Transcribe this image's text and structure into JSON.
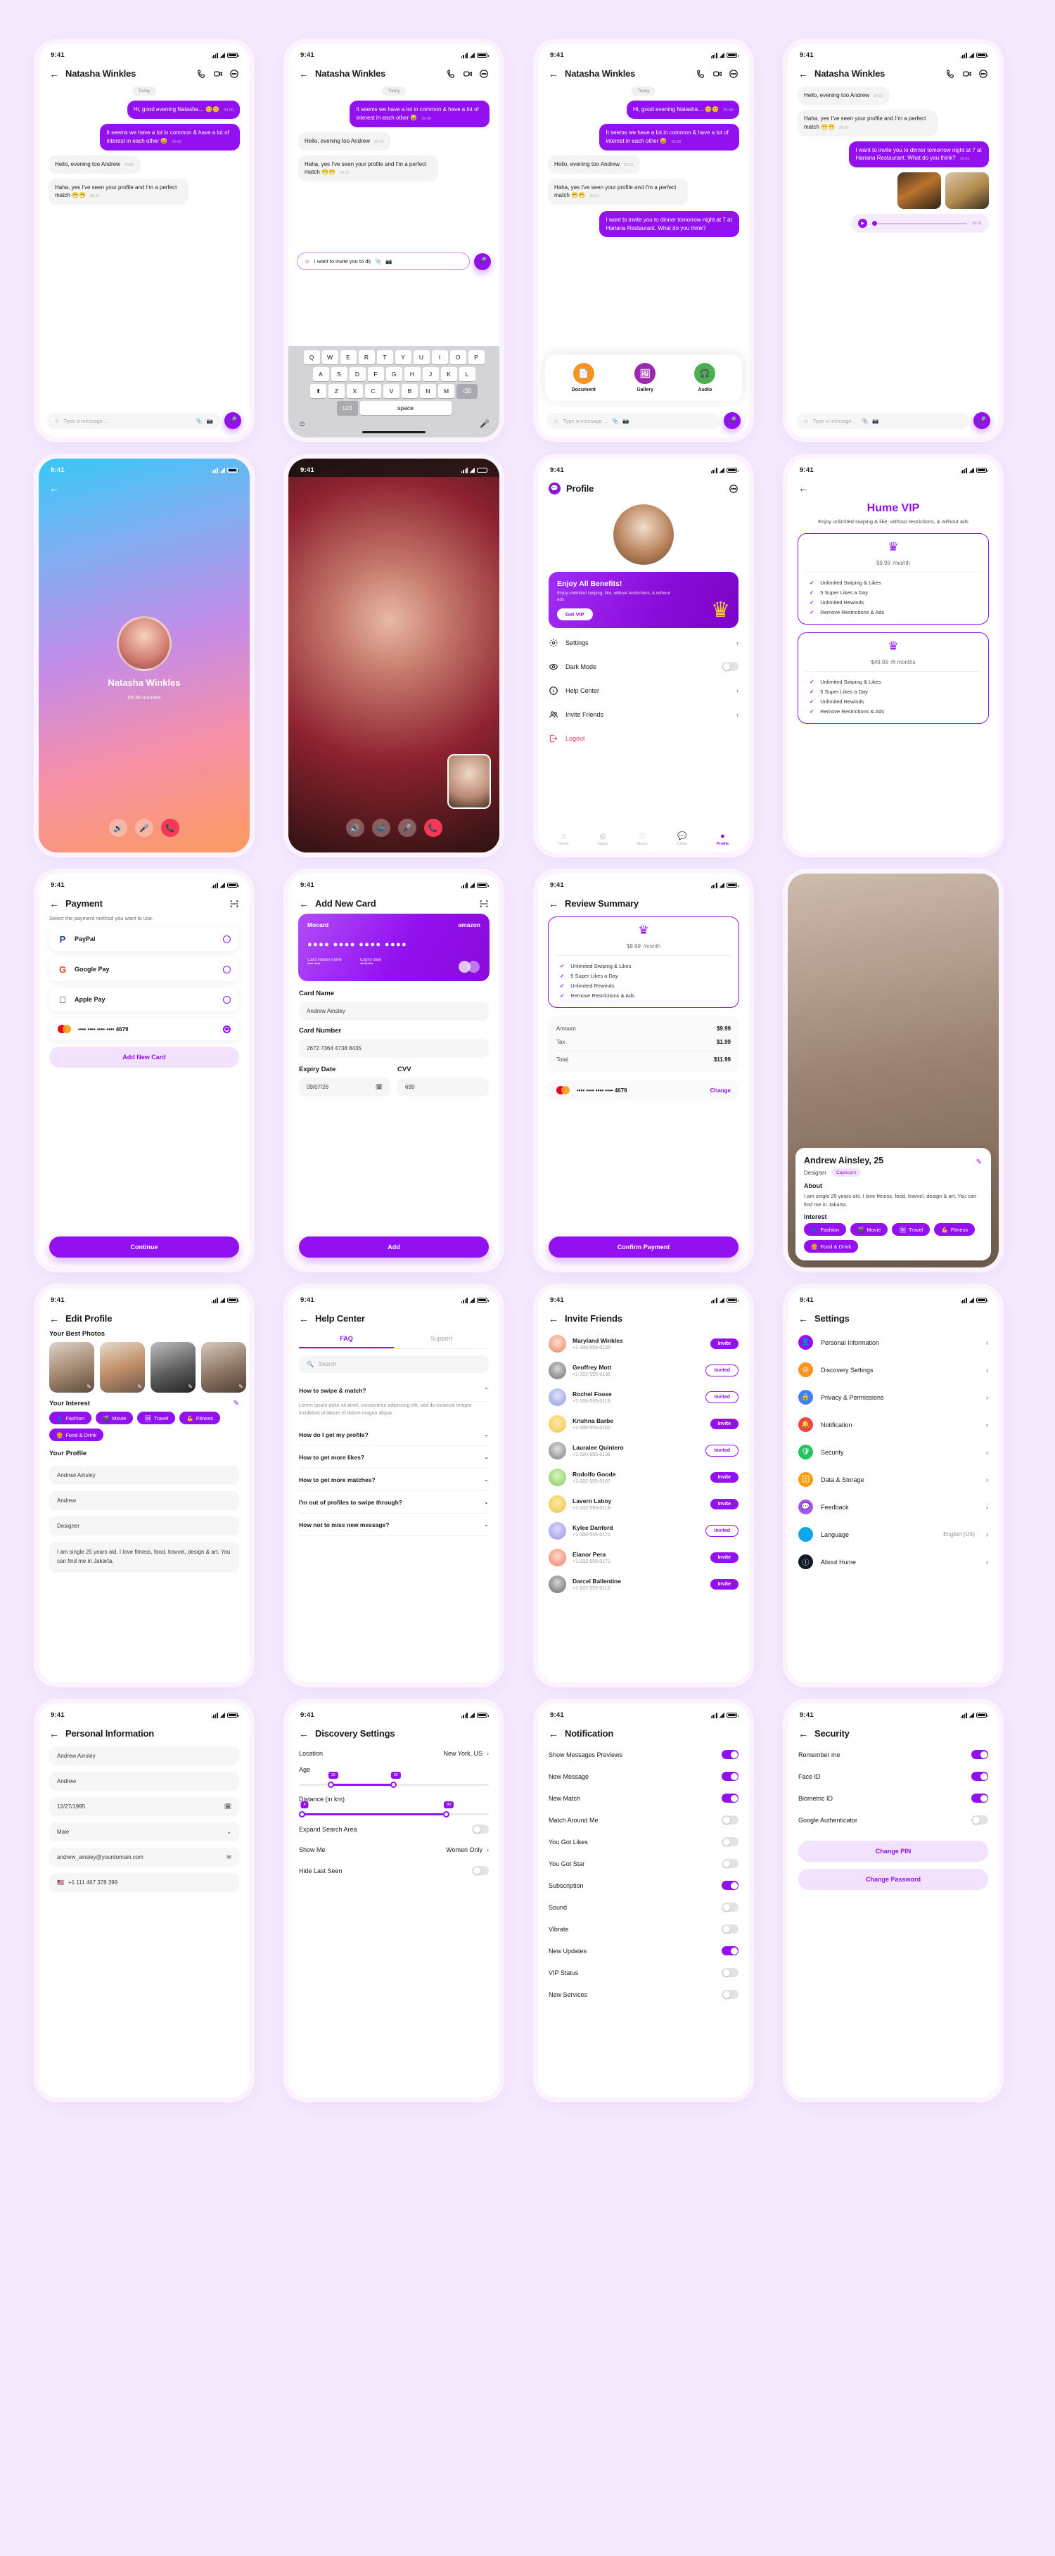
{
  "status_bar": {
    "time": "9:41"
  },
  "chat": {
    "contact": "Natasha Winkles",
    "day_label": "Today",
    "messages": [
      {
        "text": "Hi, good evening Natasha… 😊😊",
        "time": "20.00",
        "side": "out"
      },
      {
        "text": "It seems we have a lot in common & have a lot of interest in each other 😅",
        "time": "20.00",
        "side": "out"
      },
      {
        "text": "Hello, evening too Andrew",
        "time": "20.01",
        "side": "in"
      },
      {
        "text": "Haha, yes I've seen your profile and I'm a perfect match 😁😁",
        "time": "20.01",
        "side": "in"
      },
      {
        "text": "I want to invite you to dinner tomorrow night at 7 at Hariana Restaurant. What do you think?",
        "time": "20.01",
        "side": "out"
      }
    ],
    "voice_time": "20.01",
    "composer_placeholder": "Type a message ...",
    "composer_typed": "I want to invite you to di|",
    "attachments": [
      {
        "label": "Document",
        "color": "#f79421",
        "icon": "document-icon"
      },
      {
        "label": "Gallery",
        "color": "#9c27b0",
        "icon": "gallery-icon"
      },
      {
        "label": "Audio",
        "color": "#4caf50",
        "icon": "audio-icon"
      }
    ],
    "keyboard": {
      "row1": [
        "Q",
        "W",
        "E",
        "R",
        "T",
        "Y",
        "U",
        "I",
        "O",
        "P"
      ],
      "row2": [
        "A",
        "S",
        "D",
        "F",
        "G",
        "H",
        "J",
        "K",
        "L"
      ],
      "row3": [
        "Z",
        "X",
        "C",
        "V",
        "B",
        "N",
        "M"
      ],
      "shift": "⬆",
      "backspace": "⌫",
      "num": "123",
      "space": "space"
    }
  },
  "call": {
    "name": "Natasha Winkles",
    "duration": "04:35 minutes"
  },
  "profile": {
    "title": "Profile",
    "banner": {
      "heading": "Enjoy All Benefits!",
      "sub": "Enjoy unlimited swiping, like, without restrictions, & without ads",
      "cta": "Get VIP"
    },
    "menu": [
      {
        "label": "Settings",
        "icon": "gear-icon",
        "type": "chevron"
      },
      {
        "label": "Dark Mode",
        "icon": "eye-icon",
        "type": "toggle",
        "on": false
      },
      {
        "label": "Help Center",
        "icon": "info-icon",
        "type": "chevron"
      },
      {
        "label": "Invite Friends",
        "icon": "people-icon",
        "type": "chevron"
      },
      {
        "label": "Logout",
        "icon": "logout-icon",
        "type": "danger"
      }
    ],
    "tabs": [
      {
        "label": "Home",
        "icon": "home-icon",
        "active": false
      },
      {
        "label": "Maps",
        "icon": "compass-icon",
        "active": false
      },
      {
        "label": "Match",
        "icon": "heart-icon",
        "active": false
      },
      {
        "label": "Chats",
        "icon": "chat-icon",
        "active": false
      },
      {
        "label": "Profile",
        "icon": "person-icon",
        "active": true
      }
    ]
  },
  "vip": {
    "title": "Hume VIP",
    "subtitle": "Enjoy unlimited swiping & like, without restrictions, & without ads",
    "plans": [
      {
        "price": "$9.99",
        "period": "/month",
        "features": [
          "Unlimited Swiping & Likes",
          "5 Super Likes a Day",
          "Unlimited Rewinds",
          "Remove Restrictions & Ads"
        ]
      },
      {
        "price": "$49.99",
        "period": "/6 months",
        "features": [
          "Unlimited Swiping & Likes",
          "5 Super Likes a Day",
          "Unlimited Rewinds",
          "Remove Restrictions & Ads"
        ]
      }
    ]
  },
  "payment": {
    "title": "Payment",
    "subtitle": "Select the payment method you want to use.",
    "methods": [
      {
        "name": "PayPal",
        "selected": false,
        "icon": "paypal-icon"
      },
      {
        "name": "Google Pay",
        "selected": false,
        "icon": "google-icon"
      },
      {
        "name": "Apple Pay",
        "selected": false,
        "icon": "apple-icon"
      },
      {
        "name": "•••• •••• •••• •••• 4679",
        "selected": true,
        "icon": "mastercard-icon"
      }
    ],
    "add_card": "Add New Card",
    "continue": "Continue"
  },
  "add_card": {
    "title": "Add New Card",
    "card": {
      "brand": "Mocard",
      "issuer": "amazon",
      "number_mask": "●●●●  ●●●●  ●●●●  ●●●●",
      "holder_label": "Card Holder name",
      "holder_value": "•••• ••••",
      "expiry_label": "Expiry date",
      "expiry_value": "••••/••••"
    },
    "fields": [
      {
        "label": "Card Name",
        "value": "Andrew Ainsley"
      },
      {
        "label": "Card Number",
        "value": "2672 7364 4738 8435"
      }
    ],
    "expiry_label": "Expiry Date",
    "expiry_value": "09/07/26",
    "cvv_label": "CVV",
    "cvv_value": "699",
    "submit": "Add"
  },
  "review": {
    "title": "Review Summary",
    "price": "$9.99",
    "period": "/month",
    "features": [
      "Unlimited Swiping & Likes",
      "5 Super Likes a Day",
      "Unlimited Rewinds",
      "Remove Restrictions & Ads"
    ],
    "lines": [
      {
        "label": "Amount",
        "value": "$9.99"
      },
      {
        "label": "Tax",
        "value": "$1.99"
      },
      {
        "label": "Total",
        "value": "$11.99"
      }
    ],
    "card_mask": "•••• •••• •••• •••• 4679",
    "change": "Change",
    "confirm": "Confirm Payment"
  },
  "profile_detail": {
    "name": "Andrew Ainsley, 25",
    "job": "Designer",
    "zodiac": "Capricorn",
    "about_heading": "About",
    "about": "I am single 25 years old. I love fitness, food, travvel, design & art. You can find me in Jakarta.",
    "interest_heading": "Interest",
    "interests": [
      {
        "label": "Fashion",
        "emoji": "👗"
      },
      {
        "label": "Movie",
        "emoji": "🎬"
      },
      {
        "label": "Travel",
        "emoji": "🖼"
      },
      {
        "label": "Fitness",
        "emoji": "💪"
      },
      {
        "label": "Food & Drink",
        "emoji": "🍔"
      }
    ]
  },
  "edit_profile": {
    "title": "Edit Profile",
    "photos_heading": "Your Best Photos",
    "interest_heading": "Your Interest",
    "profile_heading": "Your Profile",
    "interests": [
      {
        "label": "Fashion",
        "emoji": "👗"
      },
      {
        "label": "Movie",
        "emoji": "🎬"
      },
      {
        "label": "Travel",
        "emoji": "🖼"
      },
      {
        "label": "Fitness",
        "emoji": "💪"
      },
      {
        "label": "Food & Drink",
        "emoji": "🍔"
      }
    ],
    "fields": [
      "Andrew Ainsley",
      "Andrew",
      "Designer",
      "I am single 25 years old. I love fitness, food, travvel, design & art. You can find me in Jakarta."
    ]
  },
  "help_center": {
    "title": "Help Center",
    "tabs": [
      {
        "label": "FAQ",
        "active": true
      },
      {
        "label": "Support",
        "active": false
      }
    ],
    "search_placeholder": "Search",
    "questions": [
      {
        "q": "How to swipe & match?",
        "open": true,
        "a": "Lorem ipsum dolor sit amet, consectetur adipiscing elit, sed do eiusmod tempor incididunt ut labore et dolore magna aliqua."
      },
      {
        "q": "How do I get my profile?",
        "open": false,
        "a": ""
      },
      {
        "q": "How to get more likes?",
        "open": false,
        "a": ""
      },
      {
        "q": "How to get more matches?",
        "open": false,
        "a": ""
      },
      {
        "q": "I'm out of profiles to swipe through?",
        "open": false,
        "a": ""
      },
      {
        "q": "How not to miss new message?",
        "open": false,
        "a": ""
      }
    ]
  },
  "invite_friends": {
    "title": "Invite Friends",
    "contacts": [
      {
        "name": "Maryland Winkles",
        "phone": "+1-300-555-0135",
        "state": "Invite"
      },
      {
        "name": "Geoffrey Mott",
        "phone": "+1-202-555-0136",
        "state": "Invited"
      },
      {
        "name": "Rochel Foose",
        "phone": "+1-300-555-0119",
        "state": "Invited"
      },
      {
        "name": "Krishna Barbe",
        "phone": "+1-300-555-0161",
        "state": "Invite"
      },
      {
        "name": "Lauralee Quintero",
        "phone": "+1-300-555-0136",
        "state": "Invited"
      },
      {
        "name": "Rodolfo Goode",
        "phone": "+1-202-555-0167",
        "state": "Invite"
      },
      {
        "name": "Lavern Laboy",
        "phone": "+1-202-555-0119",
        "state": "Invite"
      },
      {
        "name": "Kylee Danford",
        "phone": "+1-300-555-0171",
        "state": "Invited"
      },
      {
        "name": "Elanor Pera",
        "phone": "+1-202-555-0171",
        "state": "Invite"
      },
      {
        "name": "Darcel Ballentine",
        "phone": "+1-202-555-0112",
        "state": "Invite"
      }
    ]
  },
  "settings": {
    "title": "Settings",
    "items": [
      {
        "label": "Personal Information",
        "icon": "person-icon",
        "color": "#9310f0",
        "value": ""
      },
      {
        "label": "Discovery Settings",
        "icon": "compass-icon",
        "color": "#f79421",
        "value": ""
      },
      {
        "label": "Privacy & Permissions",
        "icon": "lock-icon",
        "color": "#3b82f6",
        "value": ""
      },
      {
        "label": "Notification",
        "icon": "bell-icon",
        "color": "#ef4444",
        "value": ""
      },
      {
        "label": "Security",
        "icon": "shield-icon",
        "color": "#22c55e",
        "value": ""
      },
      {
        "label": "Data & Storage",
        "icon": "database-icon",
        "color": "#f59e0b",
        "value": ""
      },
      {
        "label": "Feedback",
        "icon": "chat-icon",
        "color": "#a855f7",
        "value": ""
      },
      {
        "label": "Language",
        "icon": "globe-icon",
        "color": "#0ea5e9",
        "value": "English (US)"
      },
      {
        "label": "About Hume",
        "icon": "info-icon",
        "color": "#111827",
        "value": ""
      }
    ]
  },
  "personal_information": {
    "title": "Personal Information",
    "fields": [
      {
        "value": "Andrew Ainsley",
        "icon": ""
      },
      {
        "value": "Andrew",
        "icon": ""
      },
      {
        "value": "12/27/1995",
        "icon": "calendar-icon"
      },
      {
        "value": "Male",
        "icon": "chevron-down-icon"
      },
      {
        "value": "andrew_ainsley@yourdomain.com",
        "icon": "mail-icon"
      },
      {
        "value": "+1 111 467 378 399",
        "icon": "flag-icon"
      }
    ]
  },
  "discovery_settings": {
    "title": "Discovery Settings",
    "location_label": "Location",
    "location_value": "New York, US",
    "age_label": "Age",
    "age_min": "18",
    "age_max": "30",
    "distance_label": "Distance (in km)",
    "distance_min": "4",
    "distance_max": "80",
    "expand_label": "Expand Search Area",
    "expand_on": false,
    "showme_label": "Show Me",
    "showme_value": "Women Only",
    "hide_label": "Hide Last Seen",
    "hide_on": false
  },
  "notification": {
    "title": "Notification",
    "items": [
      {
        "label": "Show Messages Previews",
        "on": true
      },
      {
        "label": "New Message",
        "on": true
      },
      {
        "label": "New Match",
        "on": true
      },
      {
        "label": "Match Around Me",
        "on": false
      },
      {
        "label": "You Got Likes",
        "on": false
      },
      {
        "label": "You Got Star",
        "on": false
      },
      {
        "label": "Subscription",
        "on": true
      },
      {
        "label": "Sound",
        "on": false
      },
      {
        "label": "Vibrate",
        "on": false
      },
      {
        "label": "New Updates",
        "on": true
      },
      {
        "label": "VIP Status",
        "on": false
      },
      {
        "label": "New Services",
        "on": false
      }
    ]
  },
  "security": {
    "title": "Security",
    "items": [
      {
        "label": "Remember me",
        "on": true
      },
      {
        "label": "Face ID",
        "on": true
      },
      {
        "label": "Biometric ID",
        "on": true
      },
      {
        "label": "Google Authenticator",
        "on": false
      }
    ],
    "change_pin": "Change PIN",
    "change_password": "Change Password"
  },
  "colors": {
    "accent": "#9310f0",
    "bg": "#f4e9fd",
    "danger": "#f5385a",
    "gold": "#ffd02e"
  }
}
